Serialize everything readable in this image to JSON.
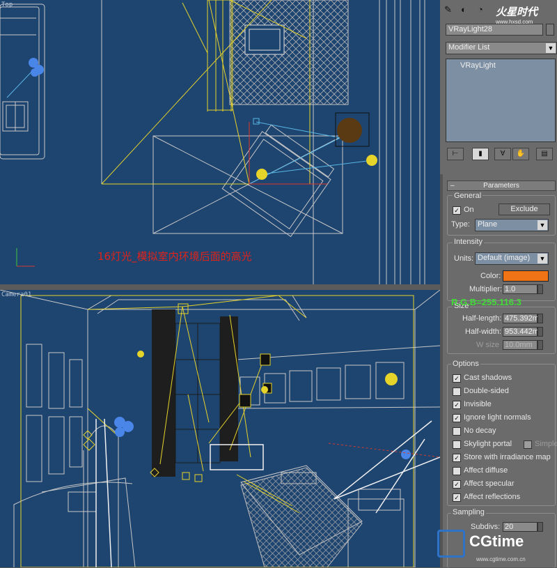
{
  "viewports": {
    "top_label": "Top",
    "camera_label": "Camera01",
    "annotation": "16灯光_模拟室内环境后面的高光"
  },
  "panel": {
    "object_name": "VRayLight28",
    "modifier_list": "Modifier List",
    "stack_item": "VRayLight",
    "color_swatch": "#f07416",
    "parameters_title": "Parameters",
    "general": {
      "title": "General",
      "on_label": "On",
      "on_checked": true,
      "exclude_label": "Exclude",
      "type_label": "Type:",
      "type_value": "Plane"
    },
    "intensity": {
      "title": "Intensity",
      "units_label": "Units:",
      "units_value": "Default (image)",
      "color_label": "Color:",
      "multiplier_label": "Multiplier:",
      "multiplier_value": "1.0",
      "rgb_overlay": "R.G.B=255.116.3"
    },
    "size": {
      "title": "Size",
      "half_length_label": "Half-length:",
      "half_length_value": "475.392m",
      "half_width_label": "Half-width:",
      "half_width_value": "953.442m",
      "w_size_label": "W size",
      "w_size_value": "10.0mm"
    },
    "options": {
      "title": "Options",
      "items": [
        {
          "label": "Cast shadows",
          "checked": true
        },
        {
          "label": "Double-sided",
          "checked": false
        },
        {
          "label": "Invisible",
          "checked": true
        },
        {
          "label": "Ignore light normals",
          "checked": true
        },
        {
          "label": "No decay",
          "checked": false
        },
        {
          "label": "Skylight portal",
          "checked": false
        },
        {
          "label": "Store with irradiance map",
          "checked": true
        },
        {
          "label": "Affect diffuse",
          "checked": false
        },
        {
          "label": "Affect specular",
          "checked": true
        },
        {
          "label": "Affect reflections",
          "checked": true
        }
      ],
      "simple_label": "Simple"
    },
    "sampling": {
      "title": "Sampling",
      "subdivs_label": "Subdivs:",
      "subdivs_value": "20"
    }
  },
  "watermarks": {
    "top_logo": "火星时代",
    "top_url": "www.hxsd.com",
    "bottom_logo": "CGtime",
    "bottom_url": "www.cgtime.com.cn"
  }
}
